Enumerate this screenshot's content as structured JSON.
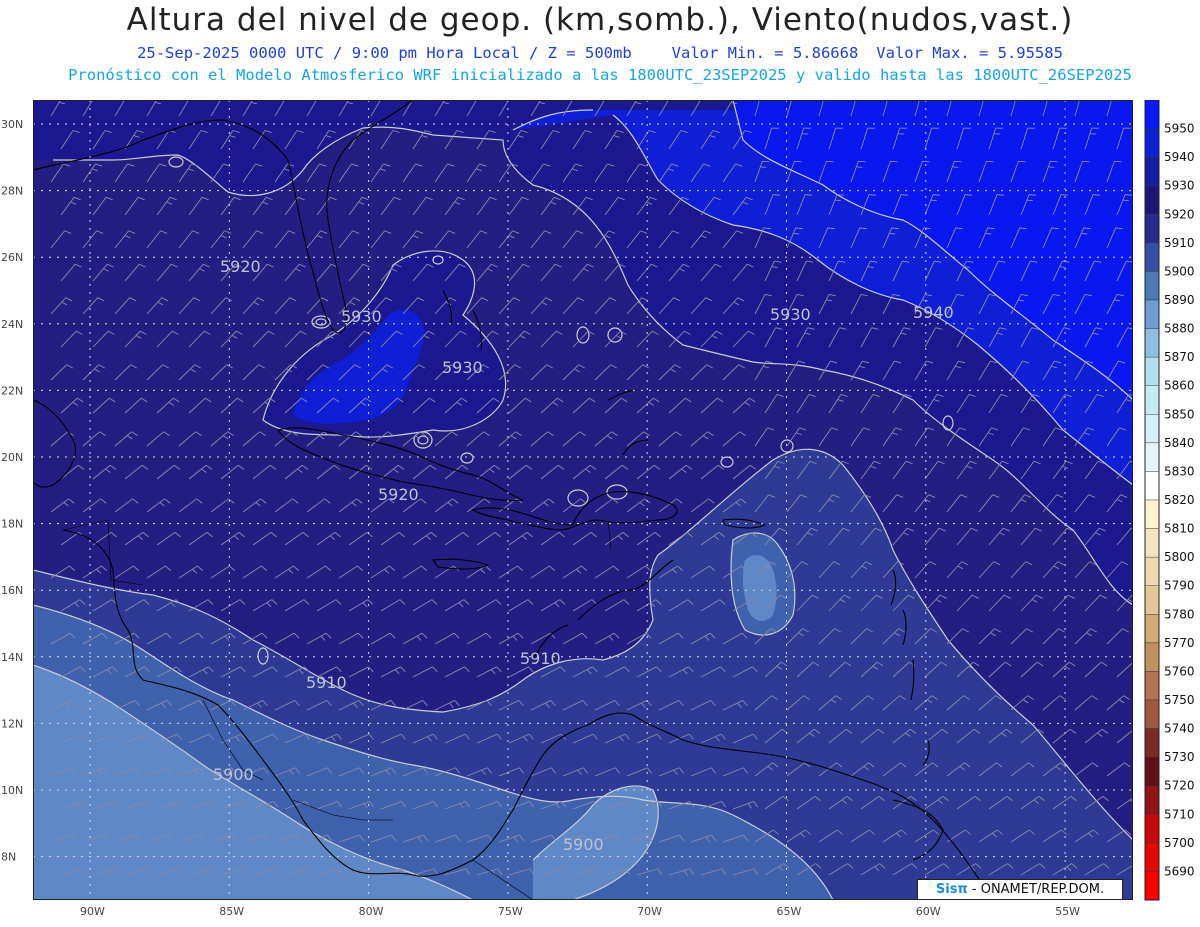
{
  "header": {
    "title": "Altura del nivel de geop. (km,somb.), Viento(nudos,vast.)",
    "date_time": "25-Sep-2025  0000 UTC / 9:00 pm Hora Local / Z = 500mb",
    "min_value": "Valor Min. = 5.86668",
    "max_value": "Valor Max. = 5.95585",
    "model_info": "Pronóstico con el Modelo Atmosferico WRF inicializado a las 1800UTC_23SEP2025 y valido hasta las  1800UTC_26SEP2025"
  },
  "map": {
    "lon_labels": [
      "90W",
      "85W",
      "80W",
      "75W",
      "70W",
      "65W",
      "60W",
      "55W"
    ],
    "lat_labels": [
      "30N",
      "28N",
      "26N",
      "24N",
      "22N",
      "20N",
      "18N",
      "16N",
      "14N",
      "12N",
      "10N",
      "8N"
    ],
    "contour_labels": [
      "5920",
      "5930",
      "5930",
      "5920",
      "5930",
      "5940",
      "5910",
      "5910",
      "5900",
      "5900"
    ],
    "shade_colors": {
      "c5890": "#5f88c6",
      "c5900": "#3f62ad",
      "c5910": "#2e3a94",
      "c5920": "#251e82",
      "c5930": "#1c1890",
      "c5940": "#0f1fd6",
      "c5950": "#0a18f0"
    }
  },
  "colorbar": {
    "labels": [
      "5950",
      "5940",
      "5930",
      "5920",
      "5910",
      "5900",
      "5890",
      "5880",
      "5870",
      "5860",
      "5850",
      "5840",
      "5830",
      "5820",
      "5810",
      "5800",
      "5790",
      "5780",
      "5770",
      "5760",
      "5750",
      "5740",
      "5730",
      "5720",
      "5710",
      "5700",
      "5690"
    ],
    "colors": [
      "#0818f6",
      "#0f1fd6",
      "#141ea6",
      "#1b1678",
      "#2c2a8e",
      "#3550a4",
      "#4b7ab8",
      "#6b9bd0",
      "#8fbde2",
      "#b3dcec",
      "#c8e8f2",
      "#d6eef7",
      "#e3f4fa",
      "#ffffff",
      "#fbf2d0",
      "#f3e5c2",
      "#ecd9b0",
      "#e2c896",
      "#d1aa74",
      "#c39060",
      "#b17452",
      "#9e5a40",
      "#7c2a28",
      "#660f18",
      "#92141a",
      "#c80a0a",
      "#e60606",
      "#fb0000"
    ]
  },
  "credit": {
    "brand": "Sisπ",
    "org": " - ONAMET/REP.DOM."
  }
}
